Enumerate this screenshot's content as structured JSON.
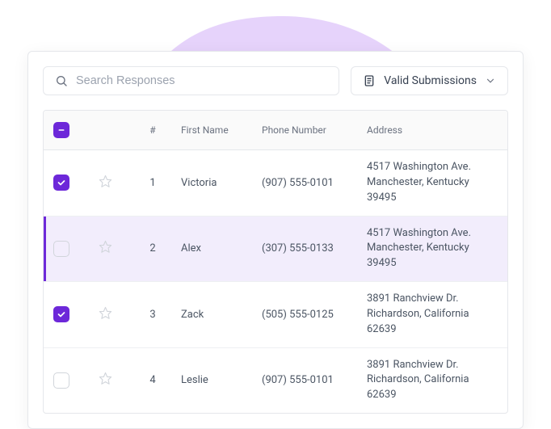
{
  "colors": {
    "accent": "#6d28d9",
    "blob": "#e6d3fb"
  },
  "search": {
    "placeholder": "Search Responses"
  },
  "filter": {
    "label": "Valid Submissions"
  },
  "table": {
    "headers": {
      "index": "#",
      "firstName": "First Name",
      "phone": "Phone Number",
      "address": "Address"
    },
    "rows": [
      {
        "checked": true,
        "starred": false,
        "highlight": false,
        "index": "1",
        "firstName": "Victoria",
        "phone": "(907) 555-0101",
        "address": "4517 Washington Ave. Manchester, Kentucky 39495"
      },
      {
        "checked": false,
        "starred": false,
        "highlight": true,
        "index": "2",
        "firstName": "Alex",
        "phone": "(307) 555-0133",
        "address": "4517 Washington Ave. Manchester, Kentucky 39495"
      },
      {
        "checked": true,
        "starred": false,
        "highlight": false,
        "index": "3",
        "firstName": "Zack",
        "phone": "(505) 555-0125",
        "address": "3891 Ranchview Dr. Richardson, California 62639"
      },
      {
        "checked": false,
        "starred": false,
        "highlight": false,
        "index": "4",
        "firstName": "Leslie",
        "phone": "(907) 555-0101",
        "address": "3891 Ranchview Dr. Richardson, California 62639"
      }
    ]
  }
}
